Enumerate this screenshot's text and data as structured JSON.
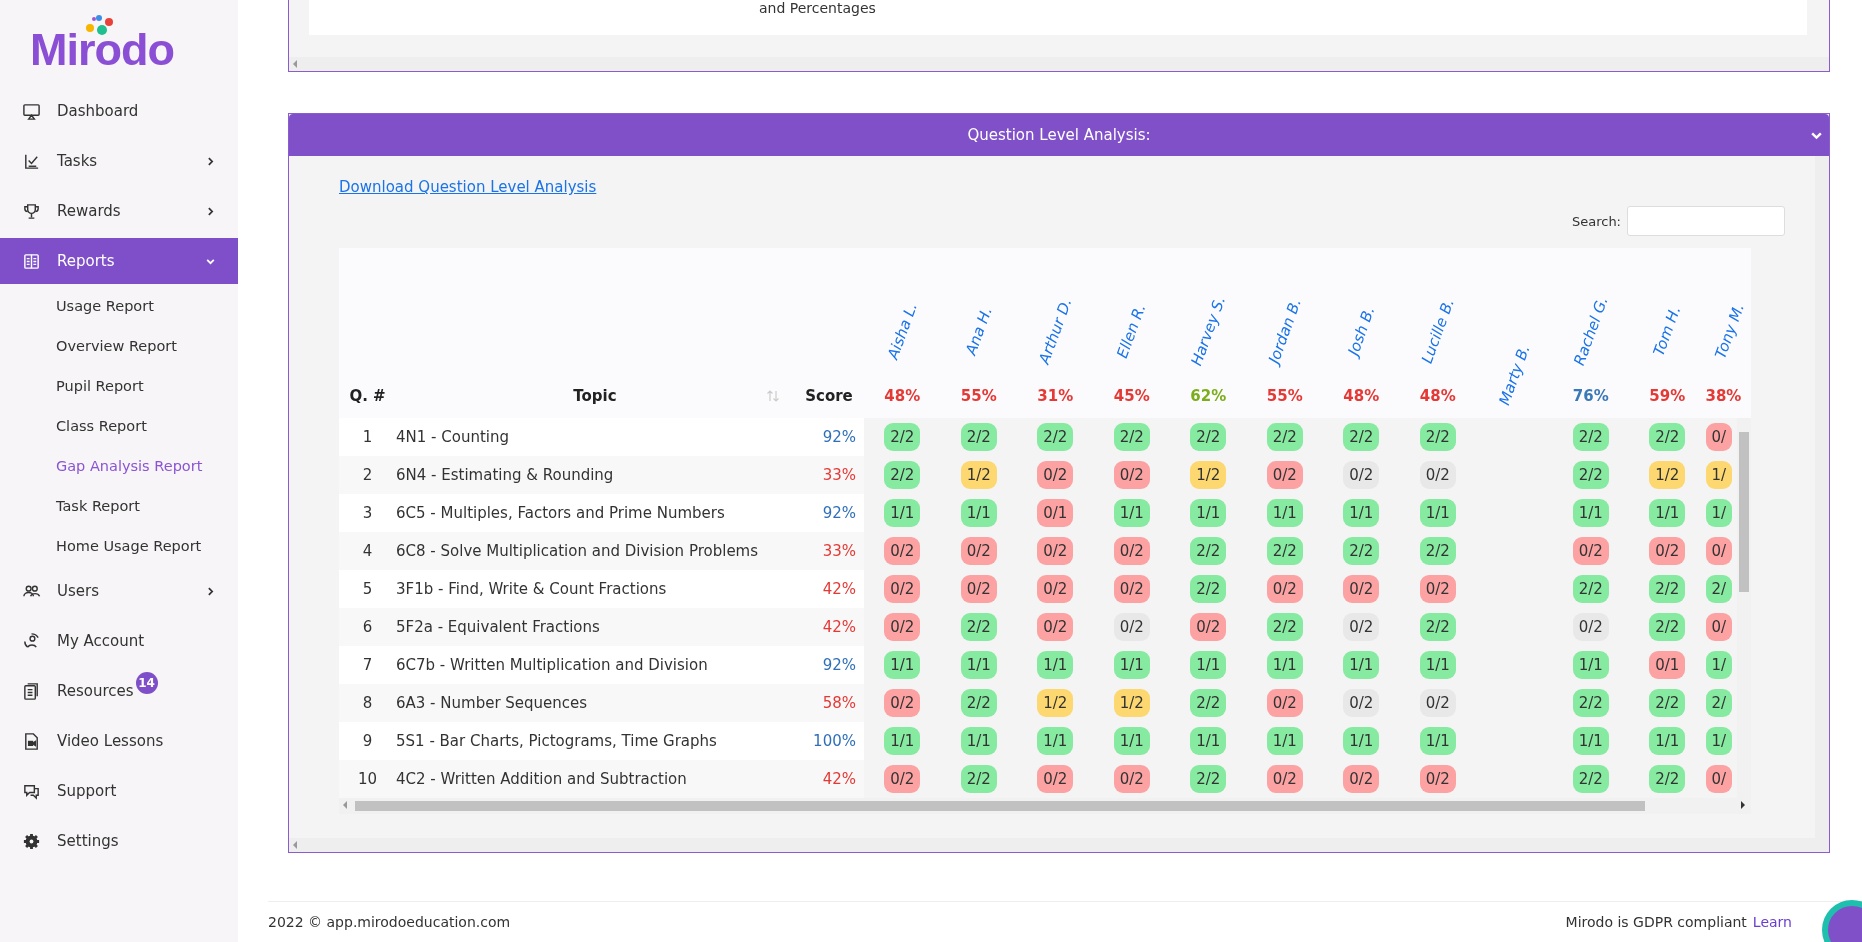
{
  "sidebar": {
    "logo": "Mirodo",
    "items": [
      {
        "label": "Dashboard",
        "selected": false
      },
      {
        "label": "Tasks",
        "selected": false,
        "expanded": false
      },
      {
        "label": "Rewards",
        "selected": false,
        "expanded": false
      },
      {
        "label": "Reports",
        "selected": true,
        "expanded": true,
        "children": [
          {
            "label": "Usage Report",
            "selected": false
          },
          {
            "label": "Overview Report",
            "selected": false
          },
          {
            "label": "Pupil Report",
            "selected": false
          },
          {
            "label": "Class Report",
            "selected": false
          },
          {
            "label": "Gap Analysis Report",
            "selected": true
          },
          {
            "label": "Task Report",
            "selected": false
          },
          {
            "label": "Home Usage Report",
            "selected": false
          }
        ]
      },
      {
        "label": "Users",
        "selected": false,
        "expanded": false
      },
      {
        "label": "My Account",
        "selected": false
      },
      {
        "label": "Resources",
        "selected": false,
        "badge": "14"
      },
      {
        "label": "Video Lessons",
        "selected": false
      },
      {
        "label": "Support",
        "selected": false
      },
      {
        "label": "Settings",
        "selected": false
      }
    ]
  },
  "top_panel": {
    "text": "and Percentages"
  },
  "qla_panel": {
    "title": "Question Level Analysis:",
    "expanded": true,
    "download_link": "Download Question Level Analysis",
    "search": {
      "label": "Search:"
    },
    "table": {
      "columns": {
        "q": "Q. #",
        "topic": "Topic",
        "score": "Score"
      },
      "students": [
        {
          "name": "Aisha L.",
          "score": "48%",
          "color": "#e53935"
        },
        {
          "name": "Ana H.",
          "score": "55%",
          "color": "#e53935"
        },
        {
          "name": "Arthur D.",
          "score": "31%",
          "color": "#e53935"
        },
        {
          "name": "Ellen R.",
          "score": "45%",
          "color": "#e53935"
        },
        {
          "name": "Harvey S.",
          "score": "62%",
          "color": "#7cad1c"
        },
        {
          "name": "Jordan B.",
          "score": "55%",
          "color": "#e53935"
        },
        {
          "name": "Josh B.",
          "score": "48%",
          "color": "#e53935"
        },
        {
          "name": "Lucille B.",
          "score": "48%",
          "color": "#e53935"
        },
        {
          "name": "Marty B."
        },
        {
          "name": "Rachel G.",
          "score": "76%",
          "color": "#3a78b8"
        },
        {
          "name": "Tom H.",
          "score": "59%",
          "color": "#e53935"
        },
        {
          "name": "Tony M.",
          "score": "38%",
          "color": "#e53935"
        }
      ],
      "rows": [
        {
          "q": "1",
          "topic": "4N1 - Counting",
          "score": "92%",
          "color": "#2f6fba",
          "results": [
            {
              "text": "2/2",
              "kind": "correct"
            },
            {
              "text": "2/2",
              "kind": "correct"
            },
            {
              "text": "2/2",
              "kind": "correct"
            },
            {
              "text": "2/2",
              "kind": "correct"
            },
            {
              "text": "2/2",
              "kind": "correct"
            },
            {
              "text": "2/2",
              "kind": "correct"
            },
            {
              "text": "2/2",
              "kind": "correct"
            },
            {
              "text": "2/2",
              "kind": "correct"
            },
            {
              "kind": "empty"
            },
            {
              "text": "2/2",
              "kind": "correct"
            },
            {
              "text": "2/2",
              "kind": "correct"
            },
            {
              "text": "0/",
              "kind": "incorrect"
            }
          ]
        },
        {
          "q": "2",
          "topic": "6N4 - Estimating & Rounding",
          "score": "33%",
          "color": "#e53935",
          "results": [
            {
              "text": "2/2",
              "kind": "correct"
            },
            {
              "text": "1/2",
              "kind": "partial"
            },
            {
              "text": "0/2",
              "kind": "incorrect"
            },
            {
              "text": "0/2",
              "kind": "incorrect"
            },
            {
              "text": "1/2",
              "kind": "partial"
            },
            {
              "text": "0/2",
              "kind": "incorrect"
            },
            {
              "text": "0/2",
              "kind": "unattempted"
            },
            {
              "text": "0/2",
              "kind": "unattempted"
            },
            {
              "kind": "empty"
            },
            {
              "text": "2/2",
              "kind": "correct"
            },
            {
              "text": "1/2",
              "kind": "partial"
            },
            {
              "text": "1/",
              "kind": "partial"
            }
          ]
        },
        {
          "q": "3",
          "topic": "6C5 - Multiples, Factors and Prime Numbers",
          "score": "92%",
          "color": "#2f6fba",
          "results": [
            {
              "text": "1/1",
              "kind": "correct"
            },
            {
              "text": "1/1",
              "kind": "correct"
            },
            {
              "text": "0/1",
              "kind": "incorrect"
            },
            {
              "text": "1/1",
              "kind": "correct"
            },
            {
              "text": "1/1",
              "kind": "correct"
            },
            {
              "text": "1/1",
              "kind": "correct"
            },
            {
              "text": "1/1",
              "kind": "correct"
            },
            {
              "text": "1/1",
              "kind": "correct"
            },
            {
              "kind": "empty"
            },
            {
              "text": "1/1",
              "kind": "correct"
            },
            {
              "text": "1/1",
              "kind": "correct"
            },
            {
              "text": "1/",
              "kind": "correct"
            }
          ]
        },
        {
          "q": "4",
          "topic": "6C8 - Solve Multiplication and Division Problems",
          "score": "33%",
          "color": "#e53935",
          "results": [
            {
              "text": "0/2",
              "kind": "incorrect"
            },
            {
              "text": "0/2",
              "kind": "incorrect"
            },
            {
              "text": "0/2",
              "kind": "incorrect"
            },
            {
              "text": "0/2",
              "kind": "incorrect"
            },
            {
              "text": "2/2",
              "kind": "correct"
            },
            {
              "text": "2/2",
              "kind": "correct"
            },
            {
              "text": "2/2",
              "kind": "correct"
            },
            {
              "text": "2/2",
              "kind": "correct"
            },
            {
              "kind": "empty"
            },
            {
              "text": "0/2",
              "kind": "incorrect"
            },
            {
              "text": "0/2",
              "kind": "incorrect"
            },
            {
              "text": "0/",
              "kind": "incorrect"
            }
          ]
        },
        {
          "q": "5",
          "topic": "3F1b - Find, Write & Count Fractions",
          "score": "42%",
          "color": "#e53935",
          "results": [
            {
              "text": "0/2",
              "kind": "incorrect"
            },
            {
              "text": "0/2",
              "kind": "incorrect"
            },
            {
              "text": "0/2",
              "kind": "incorrect"
            },
            {
              "text": "0/2",
              "kind": "incorrect"
            },
            {
              "text": "2/2",
              "kind": "correct"
            },
            {
              "text": "0/2",
              "kind": "incorrect"
            },
            {
              "text": "0/2",
              "kind": "incorrect"
            },
            {
              "text": "0/2",
              "kind": "incorrect"
            },
            {
              "kind": "empty"
            },
            {
              "text": "2/2",
              "kind": "correct"
            },
            {
              "text": "2/2",
              "kind": "correct"
            },
            {
              "text": "2/",
              "kind": "correct"
            }
          ]
        },
        {
          "q": "6",
          "topic": "5F2a - Equivalent Fractions",
          "score": "42%",
          "color": "#e53935",
          "results": [
            {
              "text": "0/2",
              "kind": "incorrect"
            },
            {
              "text": "2/2",
              "kind": "correct"
            },
            {
              "text": "0/2",
              "kind": "incorrect"
            },
            {
              "text": "0/2",
              "kind": "unattempted"
            },
            {
              "text": "0/2",
              "kind": "incorrect"
            },
            {
              "text": "2/2",
              "kind": "correct"
            },
            {
              "text": "0/2",
              "kind": "unattempted"
            },
            {
              "text": "2/2",
              "kind": "correct"
            },
            {
              "kind": "empty"
            },
            {
              "text": "0/2",
              "kind": "unattempted"
            },
            {
              "text": "2/2",
              "kind": "correct"
            },
            {
              "text": "0/",
              "kind": "incorrect"
            }
          ]
        },
        {
          "q": "7",
          "topic": "6C7b - Written Multiplication and Division",
          "score": "92%",
          "color": "#2f6fba",
          "results": [
            {
              "text": "1/1",
              "kind": "correct"
            },
            {
              "text": "1/1",
              "kind": "correct"
            },
            {
              "text": "1/1",
              "kind": "correct"
            },
            {
              "text": "1/1",
              "kind": "correct"
            },
            {
              "text": "1/1",
              "kind": "correct"
            },
            {
              "text": "1/1",
              "kind": "correct"
            },
            {
              "text": "1/1",
              "kind": "correct"
            },
            {
              "text": "1/1",
              "kind": "correct"
            },
            {
              "kind": "empty"
            },
            {
              "text": "1/1",
              "kind": "correct"
            },
            {
              "text": "0/1",
              "kind": "incorrect"
            },
            {
              "text": "1/",
              "kind": "correct"
            }
          ]
        },
        {
          "q": "8",
          "topic": "6A3 - Number Sequences",
          "score": "58%",
          "color": "#e53935",
          "results": [
            {
              "text": "0/2",
              "kind": "incorrect"
            },
            {
              "text": "2/2",
              "kind": "correct"
            },
            {
              "text": "1/2",
              "kind": "partial"
            },
            {
              "text": "1/2",
              "kind": "partial"
            },
            {
              "text": "2/2",
              "kind": "correct"
            },
            {
              "text": "0/2",
              "kind": "incorrect"
            },
            {
              "text": "0/2",
              "kind": "unattempted"
            },
            {
              "text": "0/2",
              "kind": "unattempted"
            },
            {
              "kind": "empty"
            },
            {
              "text": "2/2",
              "kind": "correct"
            },
            {
              "text": "2/2",
              "kind": "correct"
            },
            {
              "text": "2/",
              "kind": "correct"
            }
          ]
        },
        {
          "q": "9",
          "topic": "5S1 - Bar Charts, Pictograms, Time Graphs",
          "score": "100%",
          "color": "#2f6fba",
          "results": [
            {
              "text": "1/1",
              "kind": "correct"
            },
            {
              "text": "1/1",
              "kind": "correct"
            },
            {
              "text": "1/1",
              "kind": "correct"
            },
            {
              "text": "1/1",
              "kind": "correct"
            },
            {
              "text": "1/1",
              "kind": "correct"
            },
            {
              "text": "1/1",
              "kind": "correct"
            },
            {
              "text": "1/1",
              "kind": "correct"
            },
            {
              "text": "1/1",
              "kind": "correct"
            },
            {
              "kind": "empty"
            },
            {
              "text": "1/1",
              "kind": "correct"
            },
            {
              "text": "1/1",
              "kind": "correct"
            },
            {
              "text": "1/",
              "kind": "correct"
            }
          ]
        },
        {
          "q": "10",
          "topic": "4C2 - Written Addition and Subtraction",
          "score": "42%",
          "color": "#e53935",
          "results": [
            {
              "text": "0/2",
              "kind": "incorrect"
            },
            {
              "text": "2/2",
              "kind": "correct"
            },
            {
              "text": "0/2",
              "kind": "incorrect"
            },
            {
              "text": "0/2",
              "kind": "incorrect"
            },
            {
              "text": "2/2",
              "kind": "correct"
            },
            {
              "text": "0/2",
              "kind": "incorrect"
            },
            {
              "text": "0/2",
              "kind": "incorrect"
            },
            {
              "text": "0/2",
              "kind": "incorrect"
            },
            {
              "kind": "empty"
            },
            {
              "text": "2/2",
              "kind": "correct"
            },
            {
              "text": "2/2",
              "kind": "correct"
            },
            {
              "text": "0/",
              "kind": "incorrect"
            }
          ]
        }
      ]
    }
  },
  "footer": {
    "copyright": "2022 © app.mirodoeducation.com",
    "gdpr": "Mirodo is GDPR compliant",
    "learn_link": "Learn"
  }
}
